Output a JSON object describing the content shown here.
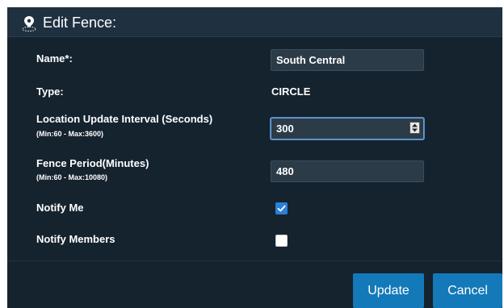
{
  "dialog": {
    "title": "Edit Fence:",
    "title_icon": "map-pin-icon"
  },
  "form": {
    "name_label": "Name*:",
    "name_value": "South Central",
    "type_label": "Type:",
    "type_value": "CIRCLE",
    "interval_label": "Location Update Interval (Seconds)",
    "interval_hint": "(Min:60 - Max:3600)",
    "interval_value": "300",
    "period_label": "Fence Period(Minutes)",
    "period_hint": "(Min:60 - Max:10080)",
    "period_value": "480",
    "notify_me_label": "Notify Me",
    "notify_me_checked": true,
    "notify_members_label": "Notify Members",
    "notify_members_checked": false
  },
  "buttons": {
    "update_label": "Update",
    "cancel_label": "Cancel"
  },
  "colors": {
    "panel_background": "#15232f",
    "accent_blue": "#1479b9",
    "checkbox_blue": "#2a7fd6"
  }
}
